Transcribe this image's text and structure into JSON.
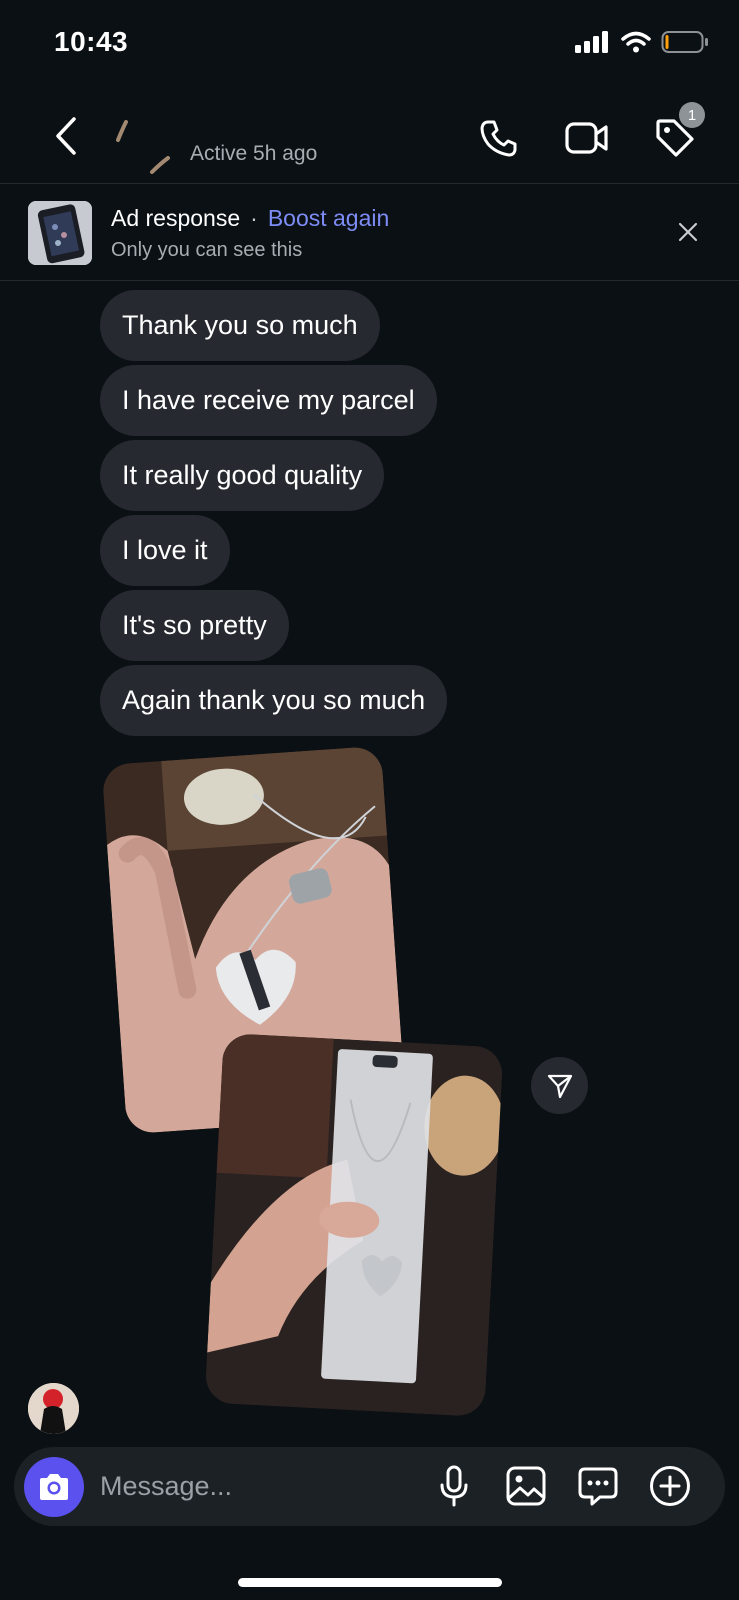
{
  "status_bar": {
    "time": "10:43"
  },
  "header": {
    "active_status": "Active 5h ago",
    "tag_badge_count": "1",
    "icons": [
      "back-chevron-icon",
      "phone-icon",
      "video-camera-icon",
      "tag-icon"
    ]
  },
  "ad_banner": {
    "title": "Ad response",
    "separator": "·",
    "boost_label": "Boost again",
    "subtitle": "Only you can see this"
  },
  "messages": [
    {
      "text": "Thank you so much"
    },
    {
      "text": "I have receive my parcel"
    },
    {
      "text": "It really good quality"
    },
    {
      "text": "I love it"
    },
    {
      "text": "It's so pretty"
    },
    {
      "text": "Again thank you so much"
    }
  ],
  "composer": {
    "placeholder": "Message...",
    "icons": [
      "camera-icon",
      "microphone-icon",
      "gallery-icon",
      "chat-bubble-icon",
      "plus-circle-icon"
    ]
  },
  "colors": {
    "background": "#0b1014",
    "bubble": "#262a30",
    "accent_link": "#7d8cf5",
    "camera_button": "#5b51ee"
  }
}
